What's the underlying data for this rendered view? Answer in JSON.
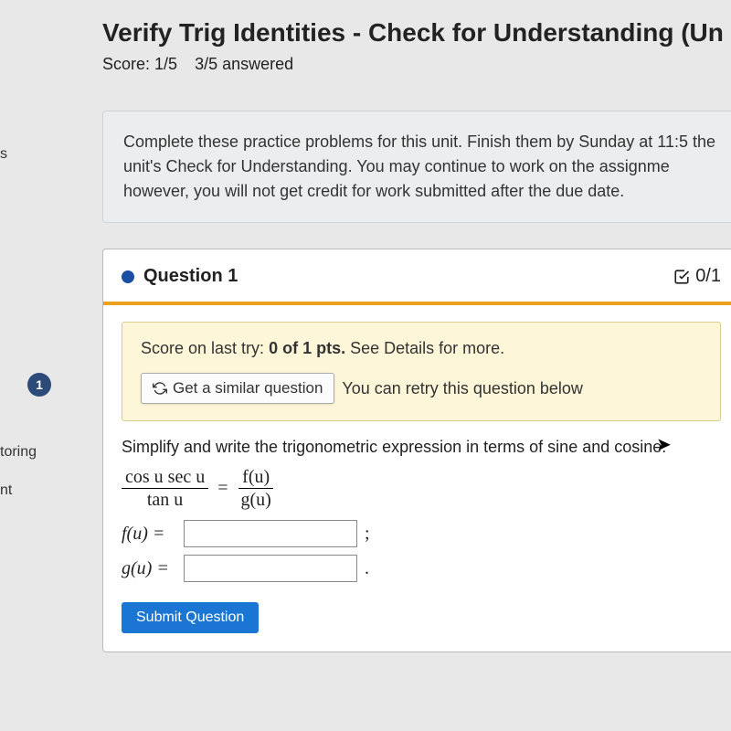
{
  "header": {
    "title": "Verify Trig Identities - Check for Understanding (Un",
    "score_label": "Score: 1/5",
    "answered_label": "3/5 answered"
  },
  "info": {
    "text": "Complete these practice problems for this unit. Finish them by Sunday at 11:5\nthe unit's Check for Understanding. You may continue to work on the assignme\nhowever, you will not get credit for work submitted after the due date."
  },
  "sidebar": {
    "s_label": "s",
    "q_number": "1",
    "toring": "toring",
    "nt": "nt"
  },
  "question": {
    "label": "Question 1",
    "points": "0/1",
    "feedback_prefix": "Score on last try: ",
    "feedback_bold": "0 of 1 pts.",
    "feedback_suffix": " See Details for more.",
    "similar_btn": "Get a similar question",
    "retry_text": "You can retry this question below",
    "prompt": "Simplify and write the trigonometric expression in terms of sine and cosine:",
    "lhs_num": "cos u sec u",
    "lhs_den": "tan u",
    "rhs_num": "f(u)",
    "rhs_den": "g(u)",
    "f_label": "f(u) =",
    "g_label": "g(u) =",
    "semicolon": ";",
    "period": ".",
    "submit": "Submit Question"
  }
}
